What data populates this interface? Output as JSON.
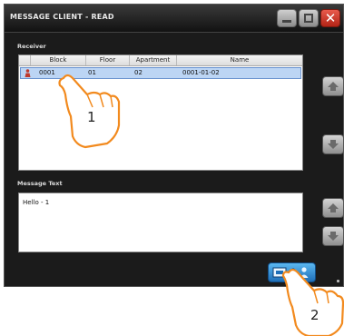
{
  "window": {
    "title": "MESSAGE CLIENT - READ"
  },
  "receiver": {
    "label": "Receiver",
    "columns": [
      "Block",
      "Floor",
      "Apartment",
      "Name"
    ],
    "rows": [
      {
        "block": "0001",
        "floor": "01",
        "apartment": "02",
        "name": "0001-01-02",
        "icon": "person-icon"
      }
    ]
  },
  "message": {
    "label": "Message Text",
    "text": "Hello - 1"
  },
  "callouts": [
    "1",
    "2"
  ],
  "colors": {
    "window_bg": "#1b1b1b",
    "selected_row": "#bcd5f4",
    "close_button": "#d2392a",
    "send_button": "#3a94d8",
    "callout": "#f28a1e"
  }
}
